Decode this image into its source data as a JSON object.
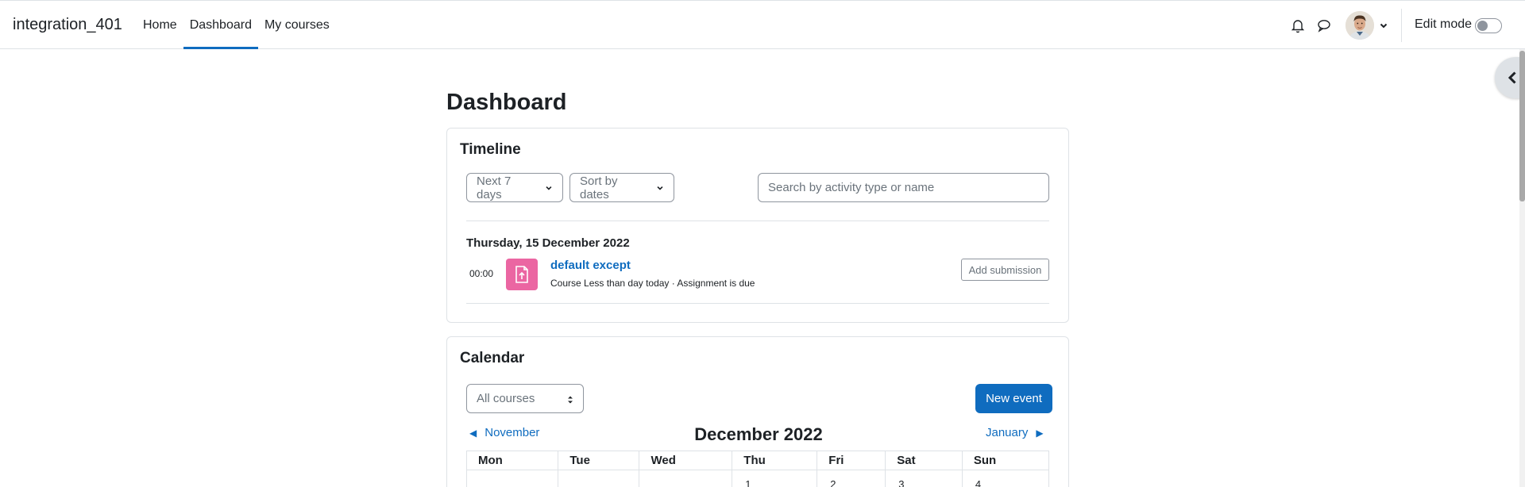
{
  "navbar": {
    "brand": "integration_401",
    "links": [
      "Home",
      "Dashboard",
      "My courses"
    ],
    "active_link": "Dashboard",
    "edit_mode_label": "Edit mode",
    "edit_mode_on": false
  },
  "page": {
    "title": "Dashboard"
  },
  "timeline": {
    "title": "Timeline",
    "day_filter": "Next 7 days",
    "sort_filter": "Sort by dates",
    "search_placeholder": "Search by activity type or name",
    "date_heading": "Thursday, 15 December 2022",
    "event": {
      "time": "00:00",
      "icon": "assignment-upload-icon",
      "icon_color": "#eb66a2",
      "name": "default except",
      "meta": "Course Less than day today · Assignment is due",
      "action_label": "Add submission"
    }
  },
  "calendar": {
    "title": "Calendar",
    "course_select": "All courses",
    "new_event_label": "New event",
    "prev_month": "November",
    "next_month": "January",
    "current_month": "December 2022",
    "weekdays": [
      "Mon",
      "Tue",
      "Wed",
      "Thu",
      "Fri",
      "Sat",
      "Sun"
    ],
    "first_row": [
      "",
      "",
      "",
      "1",
      "2",
      "3",
      "4"
    ]
  },
  "colors": {
    "accent": "#0f6cbf",
    "text": "#1d2125",
    "border": "#dee2e6"
  }
}
